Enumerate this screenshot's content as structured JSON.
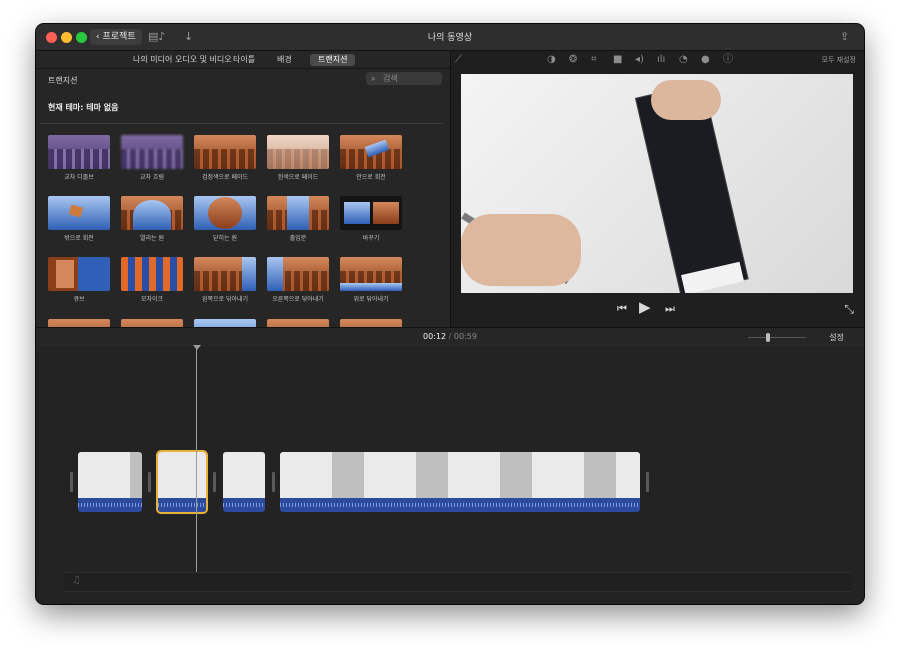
{
  "window": {
    "title": "나의 동영상",
    "back_label": "프로젝트",
    "film_icon": "film-music-icon",
    "download_icon": "download-arrow-icon",
    "share_icon": "share-icon"
  },
  "browser": {
    "tabs": [
      {
        "label": "나의 미디어"
      },
      {
        "label": "오디오 및 비디오"
      },
      {
        "label": "타이틀"
      },
      {
        "label": "배경"
      },
      {
        "label": "트랜지션",
        "active": true
      }
    ],
    "section_title": "트랜지션",
    "search_placeholder": "검색",
    "theme_label": "현재 테마: 테마 없음",
    "transitions": [
      {
        "label": "교차 디졸브"
      },
      {
        "label": "교차 흐림"
      },
      {
        "label": "검정색으로 페이드"
      },
      {
        "label": "흰색으로 페이드"
      },
      {
        "label": "안으로 회전"
      },
      {
        "label": "밖으로 회전"
      },
      {
        "label": "열리는 원"
      },
      {
        "label": "닫히는 원"
      },
      {
        "label": "출입문"
      },
      {
        "label": "바꾸기"
      },
      {
        "label": "큐브"
      },
      {
        "label": "모자이크"
      },
      {
        "label": "왼쪽으로 닦아내기"
      },
      {
        "label": "오른쪽으로 닦아내기"
      },
      {
        "label": "위로 닦아내기"
      },
      {
        "label": ""
      },
      {
        "label": ""
      },
      {
        "label": ""
      },
      {
        "label": ""
      },
      {
        "label": ""
      }
    ]
  },
  "viewer": {
    "tool_icons": [
      "magic-wand-icon",
      "color-balance-icon",
      "color-correction-icon",
      "crop-icon",
      "stabilization-icon",
      "volume-icon",
      "noise-reduction-icon",
      "speed-icon",
      "clip-filter-icon",
      "info-icon"
    ],
    "reset_all_label": "모두 재설정",
    "controls": [
      "skip-back-icon",
      "play-icon",
      "skip-forward-icon"
    ],
    "fullscreen_icon": "fullscreen-icon"
  },
  "timeline": {
    "current_time": "00:12",
    "separator": "/",
    "total_time": "00:59",
    "settings_label": "설정",
    "music_icon": "music-note-icon"
  }
}
